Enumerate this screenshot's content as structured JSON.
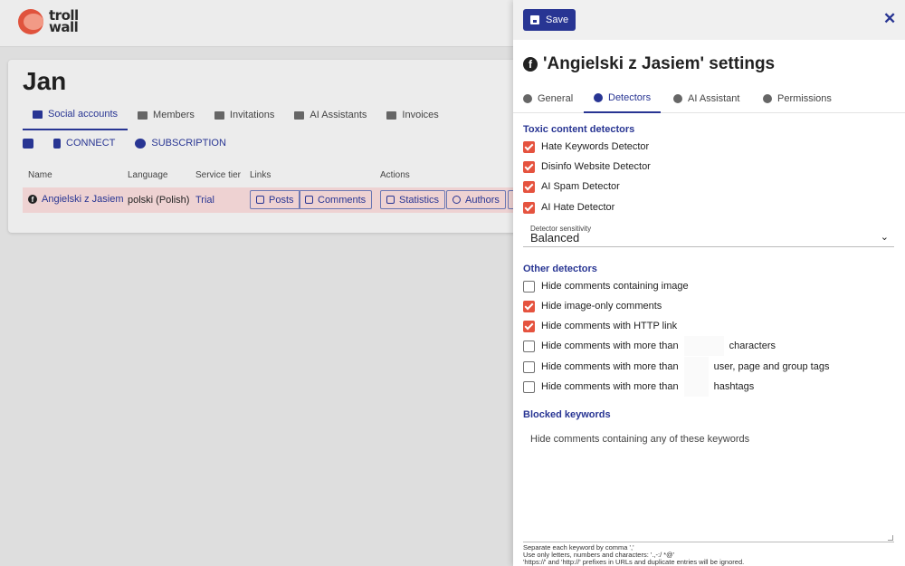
{
  "app": {
    "logo_text_1": "troll",
    "logo_text_2": "wall"
  },
  "org": {
    "name": "Jan",
    "tabs": [
      {
        "label": "Social accounts",
        "icon": "id-card-icon",
        "active": true
      },
      {
        "label": "Members",
        "icon": "users-icon"
      },
      {
        "label": "Invitations",
        "icon": "paper-plane-icon"
      },
      {
        "label": "AI Assistants",
        "icon": "robot-icon"
      },
      {
        "label": "Invoices",
        "icon": "file-icon"
      }
    ],
    "sub": {
      "connect": "CONNECT",
      "subscription": "SUBSCRIPTION"
    },
    "table": {
      "headers": [
        "Name",
        "Language",
        "Service tier",
        "Links",
        "Actions"
      ],
      "row": {
        "name": "Angielski z Jasiem",
        "language": "polski (Polish)",
        "tier": "Trial",
        "links": [
          "Posts",
          "Comments"
        ],
        "actions": [
          "Statistics",
          "Authors"
        ]
      }
    }
  },
  "drawer": {
    "save_label": "Save",
    "close_glyph": "✕",
    "title": "'Angielski z Jasiem' settings",
    "fb_glyph": "f",
    "tabs": [
      {
        "label": "General"
      },
      {
        "label": "Detectors",
        "active": true
      },
      {
        "label": "AI Assistant"
      },
      {
        "label": "Permissions"
      }
    ],
    "toxic": {
      "heading": "Toxic content detectors",
      "items": [
        {
          "label": "Hate Keywords Detector",
          "checked": true
        },
        {
          "label": "Disinfo Website Detector",
          "checked": true
        },
        {
          "label": "AI Spam Detector",
          "checked": true
        },
        {
          "label": "AI Hate Detector",
          "checked": true
        }
      ]
    },
    "sensitivity": {
      "label": "Detector sensitivity",
      "value": "Balanced"
    },
    "other": {
      "heading": "Other detectors",
      "items": [
        {
          "label": "Hide comments containing image",
          "checked": false
        },
        {
          "label": "Hide image-only comments",
          "checked": true
        },
        {
          "label": "Hide comments with HTTP link",
          "checked": true
        },
        {
          "label": "Hide comments with more than",
          "suffix": "characters",
          "checked": false
        },
        {
          "label": "Hide comments with more than",
          "suffix": "user, page and group tags",
          "checked": false
        },
        {
          "label": "Hide comments with more than",
          "suffix": "hashtags",
          "checked": false
        }
      ]
    },
    "blocked": {
      "heading": "Blocked keywords",
      "placeholder": "Hide comments containing any of these keywords",
      "help_1": "Separate each keyword by comma ','",
      "help_2": "Use only letters, numbers and characters: '.,-:/ *@'",
      "help_3": "'https://' and 'http://' prefixes in URLs and duplicate entries will be ignored."
    },
    "colors": {
      "accent": "#283593",
      "checkbox_on": "#e5533f"
    }
  }
}
